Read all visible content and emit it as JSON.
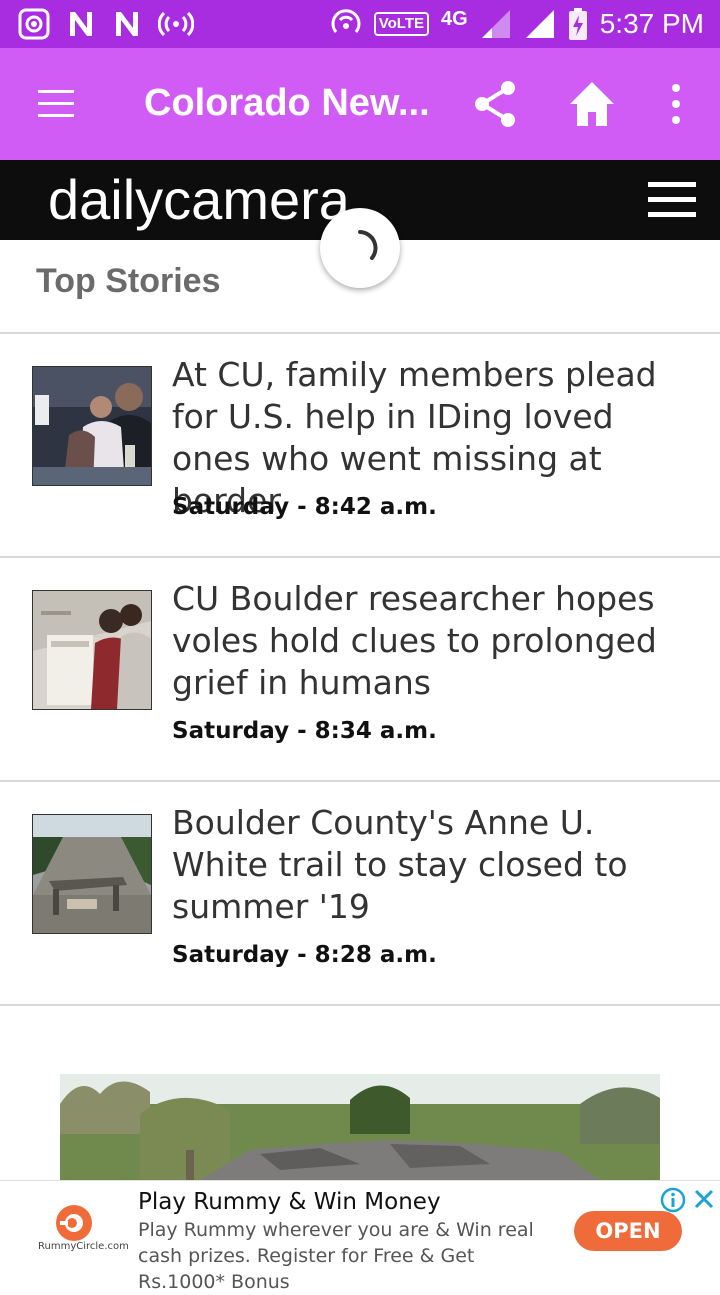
{
  "status_bar": {
    "time": "5:37 PM",
    "network": "4G",
    "volte": "VoLTE"
  },
  "app_bar": {
    "title": "Colorado New...",
    "color": "#d05cf5"
  },
  "site": {
    "logo_text": "dailycamera"
  },
  "section": {
    "title": "Top Stories"
  },
  "articles": [
    {
      "headline": "At CU, family members plead for U.S. help in IDing loved ones who went missing at border",
      "time": "Saturday - 8:42 a.m."
    },
    {
      "headline": "CU Boulder researcher hopes voles hold clues to prolonged grief in humans",
      "time": "Saturday - 8:34 a.m."
    },
    {
      "headline": "Boulder County's Anne U. White trail to stay closed to summer '19",
      "time": "Saturday - 8:28 a.m."
    }
  ],
  "ad": {
    "title": "Play Rummy & Win Money",
    "body": "Play Rummy wherever you are & Win real cash prizes. Register for Free & Get Rs.1000* Bonus",
    "button": "OPEN",
    "brand": "RummyCircle.com",
    "accent": "#ef6c3a"
  },
  "icons": [
    "menu-icon",
    "share-icon",
    "home-icon",
    "more-vert-icon",
    "site-menu-icon",
    "spinner-icon",
    "info-icon",
    "close-icon"
  ]
}
